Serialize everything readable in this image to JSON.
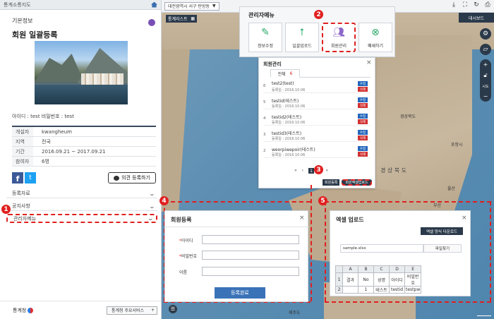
{
  "left_panel": {
    "topbar_title": "통계소통지도",
    "section_title": "기본정보",
    "survey_title": "회원 일괄등록",
    "id_line": "아이디 : test 비밀번호 : test",
    "info_rows": [
      {
        "key": "개설자",
        "value": "kwangheum"
      },
      {
        "key": "지역",
        "value": "전국"
      },
      {
        "key": "기간",
        "value": "2016.09.21 ~ 2017.09.21"
      },
      {
        "key": "참여자",
        "value": "6명"
      }
    ],
    "facebook": "f",
    "twitter": "t",
    "opinion_button": "의견 등록하기",
    "accordion": [
      "등록자료",
      "공지사항",
      "관리자메뉴"
    ],
    "footer_logo": "통계청",
    "footer_service": "통계청 주요서비스",
    "footer_plus": "+"
  },
  "map": {
    "region_select": "대전광역시 서구 탄방동",
    "dashboard_button": "대시보드",
    "list_button": "통계리스트",
    "zoom_label": "시도",
    "zoom_plus": "+",
    "zoom_minus": "−",
    "cities": [
      {
        "name": "경상북도",
        "big": false
      },
      {
        "name": "경 상 북 도",
        "big": true
      },
      {
        "name": "포항시",
        "big": false
      },
      {
        "name": "울산",
        "big": false
      },
      {
        "name": "부산",
        "big": false
      },
      {
        "name": "제주도",
        "big": false
      }
    ]
  },
  "admin_menu": {
    "title": "관리자메뉴",
    "buttons": [
      {
        "label": "정보수정",
        "icon": "edit-icon"
      },
      {
        "label": "일괄업로드",
        "icon": "upload-icon"
      },
      {
        "label": "회원관리",
        "icon": "people-icon"
      },
      {
        "label": "폐쇄하기",
        "icon": "close-circle-icon"
      }
    ]
  },
  "member_mgmt": {
    "title": "회원관리",
    "tab_label": "전체",
    "tab_count": "6",
    "members": [
      {
        "no": "6",
        "name": "test2(test)",
        "date": "등록일 : 2016.10.06"
      },
      {
        "no": "5",
        "name": "testid(테스트)",
        "date": "등록일 : 2016.10.06"
      },
      {
        "no": "4",
        "name": "testid2(테스트)",
        "date": "등록일 : 2016.10.06"
      },
      {
        "no": "3",
        "name": "testid3(테스트)",
        "date": "등록일 : 2016.10.06"
      },
      {
        "no": "2",
        "name": "weorpiwepoir(테스트)",
        "date": "등록일 : 2016.10.06"
      }
    ],
    "edit_label": "수정",
    "delete_label": "삭제",
    "pager": [
      "«",
      "‹",
      "1",
      "›",
      "»"
    ],
    "register_btn": "회원등록",
    "bulk_btn": "회원엑셀업로드"
  },
  "markers": [
    "1",
    "2",
    "3",
    "4",
    "5"
  ],
  "register_dialog": {
    "title": "회원등록",
    "fields": [
      {
        "required": "*",
        "label": "아이디"
      },
      {
        "required": "*",
        "label": "비밀번호"
      },
      {
        "required": "",
        "label": "이름"
      }
    ],
    "submit": "등록완료"
  },
  "excel_dialog": {
    "title": "엑셀 업로드",
    "download_btn": "엑셀 양식 다운로드",
    "file_name": "sample.xlsx",
    "find_btn": "파일찾기",
    "sheet_header": [
      "",
      "A",
      "B",
      "C",
      "D",
      "E"
    ],
    "sheet_rows": [
      [
        "1",
        "결과",
        "No",
        "성명",
        "아이디",
        "비밀번호"
      ],
      [
        "2",
        "",
        "1",
        "테스트",
        "testid",
        "testpw"
      ]
    ]
  },
  "colors": {
    "annotation": "#e02020",
    "dark": "#2b3a4a",
    "accent": "#3a72b8"
  }
}
